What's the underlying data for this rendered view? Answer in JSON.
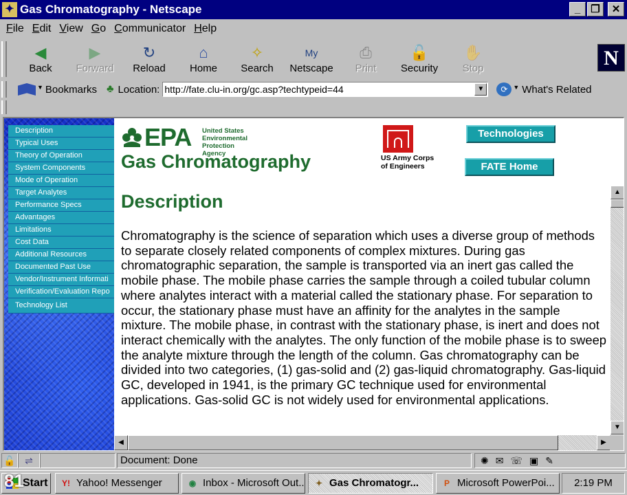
{
  "window": {
    "title": "Gas Chromatography - Netscape"
  },
  "menu": [
    {
      "label": "File",
      "key": "F",
      "rest": "ile"
    },
    {
      "label": "Edit",
      "key": "E",
      "rest": "dit"
    },
    {
      "label": "View",
      "key": "V",
      "rest": "iew"
    },
    {
      "label": "Go",
      "key": "G",
      "rest": "o"
    },
    {
      "label": "Communicator",
      "key": "C",
      "rest": "ommunicator"
    },
    {
      "label": "Help",
      "key": "H",
      "rest": "elp"
    }
  ],
  "toolbar": {
    "back": "Back",
    "forward": "Forward",
    "reload": "Reload",
    "home": "Home",
    "search": "Search",
    "netscape": "Netscape",
    "print": "Print",
    "security": "Security",
    "stop": "Stop",
    "logo": "N"
  },
  "location_bar": {
    "bookmarks": "Bookmarks",
    "location_label": "Location:",
    "url": "http://fate.clu-in.org/gc.asp?techtypeid=44",
    "whats_related": "What's Related"
  },
  "side_nav": [
    "Description",
    "Typical Uses",
    "Theory of Operation",
    "System Components",
    "Mode of Operation",
    "Target Analytes",
    "Performance Specs",
    "Advantages",
    "Limitations",
    "Cost Data",
    "Additional Resources",
    "Documented Past Use",
    "Vendor/Instrument Informati",
    "Verification/Evaluation Repo",
    "Technology List"
  ],
  "page": {
    "epa_wordmark": "EPA",
    "epa_agency_line1": "United States",
    "epa_agency_line2": "Environmental Protection",
    "epa_agency_line3": "Agency",
    "title": "Gas Chromatography",
    "usace_line1": "US Army Corps",
    "usace_line2": "of Engineers",
    "technologies_button": "Technologies",
    "fate_home_button": "FATE Home",
    "heading": "Description",
    "body": "Chromatography is the science of separation which uses a diverse group of methods to separate closely related components of complex mixtures. During gas chromatographic separation, the sample is transported via an inert gas called the mobile phase. The mobile phase carries the sample through a coiled tubular column where analytes interact with a material called the stationary phase. For separation to occur, the stationary phase must have an affinity for the analytes in the sample mixture. The mobile phase, in contrast with the stationary phase, is inert and does not interact chemically with the analytes. The only function of the mobile phase is to sweep the analyte mixture through the length of the column. Gas chromatography can be divided into two categories, (1) gas-solid and (2) gas-liquid chromatography. Gas-liquid GC, developed in 1941, is the primary GC technique used for environmental applications. Gas-solid GC is not widely used for environmental applications."
  },
  "status": {
    "text": "Document: Done"
  },
  "taskbar": {
    "start": "Start",
    "buttons": [
      {
        "label": "Yahoo! Messenger"
      },
      {
        "label": "Inbox - Microsoft Out..."
      },
      {
        "label": "Gas Chromatogr..."
      },
      {
        "label": "Microsoft PowerPoi..."
      }
    ],
    "clock": "2:19 PM"
  },
  "slide_number": "81",
  "colors": {
    "title_bar": "#000080",
    "epa_green": "#1e6b2e",
    "nav_teal": "#20a0b8",
    "usace_red": "#d01818"
  },
  "icons": {
    "back": "back-arrow-icon",
    "forward": "forward-arrow-icon",
    "reload": "reload-icon",
    "home": "home-icon",
    "search": "search-flashlight-icon",
    "netscape": "my-netscape-icon",
    "print": "printer-icon",
    "security": "padlock-icon",
    "stop": "stop-icon"
  }
}
